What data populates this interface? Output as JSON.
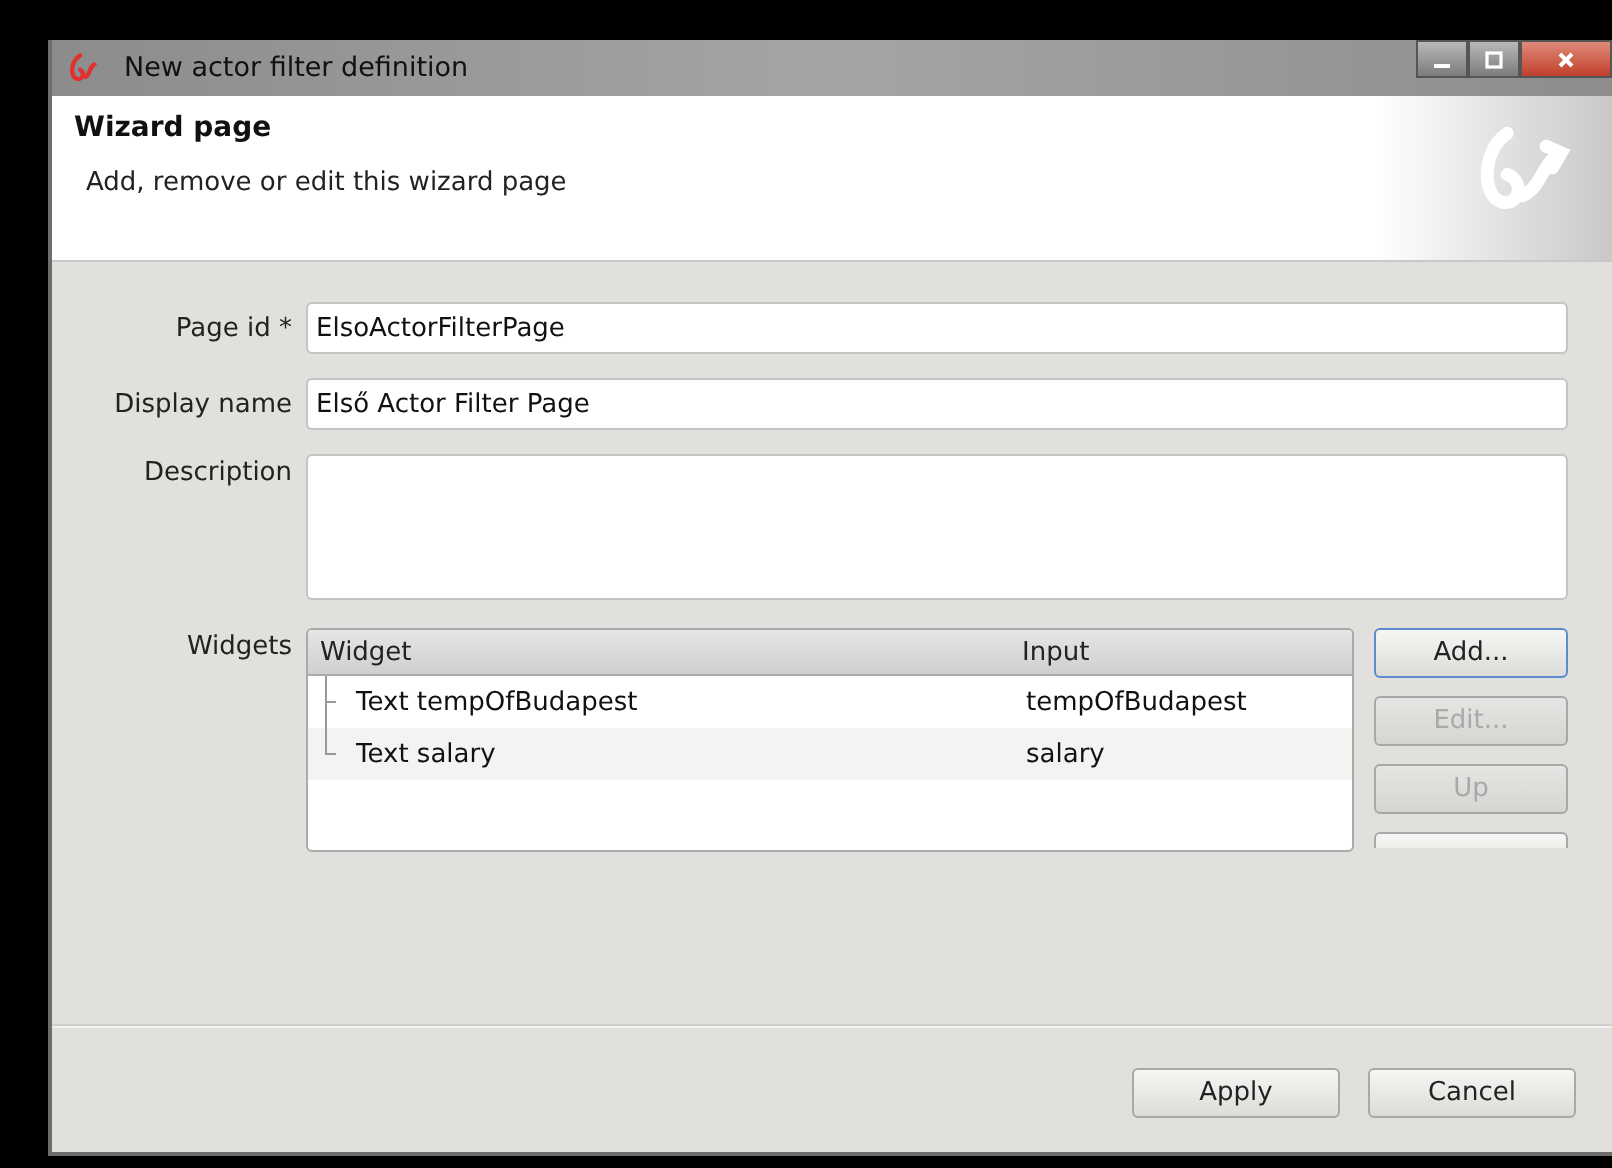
{
  "window": {
    "title": "New actor filter definition"
  },
  "header": {
    "title": "Wizard page",
    "subtitle": "Add, remove or edit this wizard page"
  },
  "form": {
    "fields": [
      {
        "label": "Page id *",
        "value": "ElsoActorFilterPage",
        "kind": "line"
      },
      {
        "label": "Display name",
        "value": "Első Actor Filter Page",
        "kind": "line"
      },
      {
        "label": "Description",
        "kind": "area"
      }
    ]
  },
  "widgets": {
    "label": "Widgets",
    "columns": [
      "Widget",
      "Input"
    ],
    "rows": [
      {
        "widget": "Text tempOfBudapest",
        "input": "tempOfBudapest"
      },
      {
        "widget": "Text salary",
        "input": "salary"
      }
    ],
    "buttons": [
      {
        "label": "Add...",
        "disabled": false,
        "default": true
      },
      {
        "label": "Edit...",
        "disabled": true,
        "default": false
      },
      {
        "label": "Up",
        "disabled": true,
        "default": false
      }
    ]
  },
  "footer_buttons": [
    {
      "label": "Apply"
    },
    {
      "label": "Cancel"
    }
  ]
}
